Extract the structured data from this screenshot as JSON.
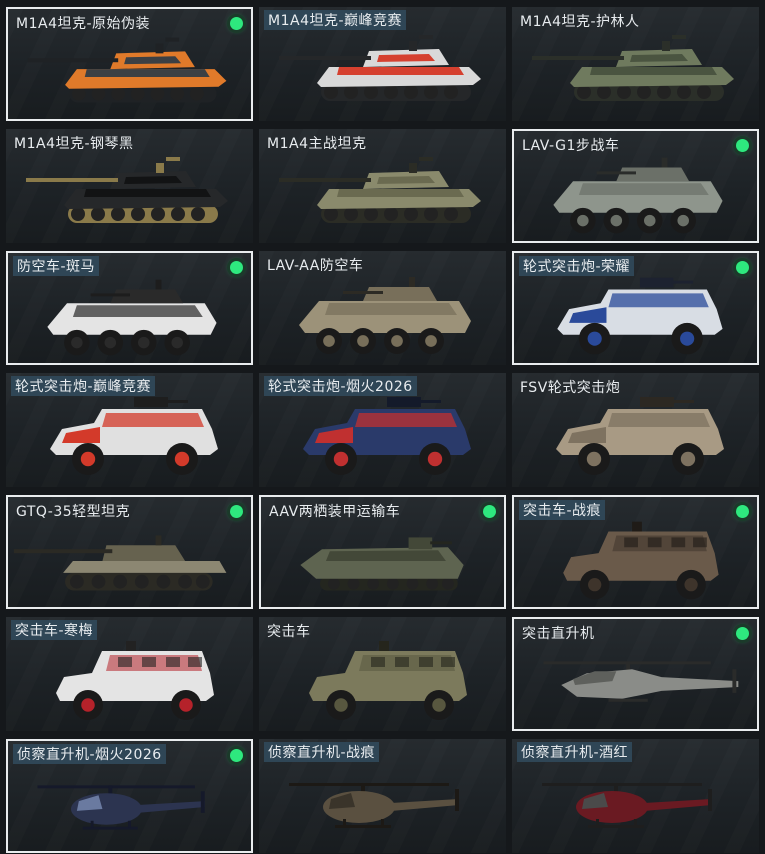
{
  "vehicles": [
    {
      "name": "M1A4坦克-原始伪装",
      "type": "tank",
      "colors": [
        "#e07a2a",
        "#3c4044",
        "#1f2225"
      ],
      "owned": true,
      "label_tag": false
    },
    {
      "name": "M1A4坦克-巅峰竞赛",
      "type": "tank",
      "colors": [
        "#d9d9d9",
        "#d5402f",
        "#252729"
      ],
      "owned": false,
      "label_tag": true
    },
    {
      "name": "M1A4坦克-护林人",
      "type": "tank",
      "colors": [
        "#6f7a5e",
        "#4a5440",
        "#2b2f29"
      ],
      "owned": false,
      "label_tag": false
    },
    {
      "name": "M1A4坦克-钢琴黑",
      "type": "tank",
      "colors": [
        "#26282a",
        "#121314",
        "#8a7a4a"
      ],
      "owned": false,
      "label_tag": false
    },
    {
      "name": "M1A4主战坦克",
      "type": "tank",
      "colors": [
        "#8a8a6c",
        "#6a6a50",
        "#2b2c25"
      ],
      "owned": false,
      "label_tag": false
    },
    {
      "name": "LAV-G1步战车",
      "type": "apc",
      "colors": [
        "#8e958c",
        "#6b7068",
        "#2a2c2a"
      ],
      "owned": true,
      "label_tag": false
    },
    {
      "name": "防空车-斑马",
      "type": "apc",
      "colors": [
        "#e4e4e4",
        "#2a2a2a",
        "#1d1d1d"
      ],
      "owned": true,
      "label_tag": true
    },
    {
      "name": "LAV-AA防空车",
      "type": "apc",
      "colors": [
        "#9c9279",
        "#786f5a",
        "#2c2a24"
      ],
      "owned": false,
      "label_tag": false
    },
    {
      "name": "轮式突击炮-荣耀",
      "type": "armored_car",
      "colors": [
        "#d8dde4",
        "#2a4a9a",
        "#1d2230"
      ],
      "owned": true,
      "label_tag": true
    },
    {
      "name": "轮式突击炮-巅峰竞赛",
      "type": "armored_car",
      "colors": [
        "#e0e0e0",
        "#d33a2a",
        "#1e1e1e"
      ],
      "owned": false,
      "label_tag": true
    },
    {
      "name": "轮式突击炮-烟火2026",
      "type": "armored_car",
      "colors": [
        "#2a3a6a",
        "#c03030",
        "#141a2a"
      ],
      "owned": false,
      "label_tag": true
    },
    {
      "name": "FSV轮式突击炮",
      "type": "armored_car",
      "colors": [
        "#a89a84",
        "#7e7260",
        "#2c2822"
      ],
      "owned": false,
      "label_tag": false
    },
    {
      "name": "GTQ-35轻型坦克",
      "type": "light_tank",
      "colors": [
        "#8c8772",
        "#66624f",
        "#2b2a24"
      ],
      "owned": true,
      "label_tag": false
    },
    {
      "name": "AAV两栖装甲运输车",
      "type": "amphibious",
      "colors": [
        "#5e6450",
        "#434838",
        "#24261f"
      ],
      "owned": true,
      "label_tag": false
    },
    {
      "name": "突击车-战痕",
      "type": "assault_vehicle",
      "colors": [
        "#6a5a4a",
        "#3e342b",
        "#1f1b17"
      ],
      "owned": true,
      "label_tag": true
    },
    {
      "name": "突击车-寒梅",
      "type": "assault_vehicle",
      "colors": [
        "#e4e4e4",
        "#b5222a",
        "#222222"
      ],
      "owned": false,
      "label_tag": true
    },
    {
      "name": "突击车",
      "type": "assault_vehicle",
      "colors": [
        "#7c7a5c",
        "#58573f",
        "#25251c"
      ],
      "owned": false,
      "label_tag": false
    },
    {
      "name": "突击直升机",
      "type": "attack_heli",
      "colors": [
        "#8a8c88",
        "#5e605c",
        "#2a2b2a"
      ],
      "owned": true,
      "label_tag": false
    },
    {
      "name": "侦察直升机-烟火2026",
      "type": "scout_heli",
      "colors": [
        "#2c3450",
        "#6a7aa0",
        "#15192a"
      ],
      "owned": true,
      "label_tag": true
    },
    {
      "name": "侦察直升机-战痕",
      "type": "scout_heli",
      "colors": [
        "#5a5040",
        "#3a342a",
        "#1c1915"
      ],
      "owned": false,
      "label_tag": true
    },
    {
      "name": "侦察直升机-酒红",
      "type": "scout_heli",
      "colors": [
        "#6a1a22",
        "#4a4a4a",
        "#1e1e1e"
      ],
      "owned": false,
      "label_tag": true
    }
  ]
}
